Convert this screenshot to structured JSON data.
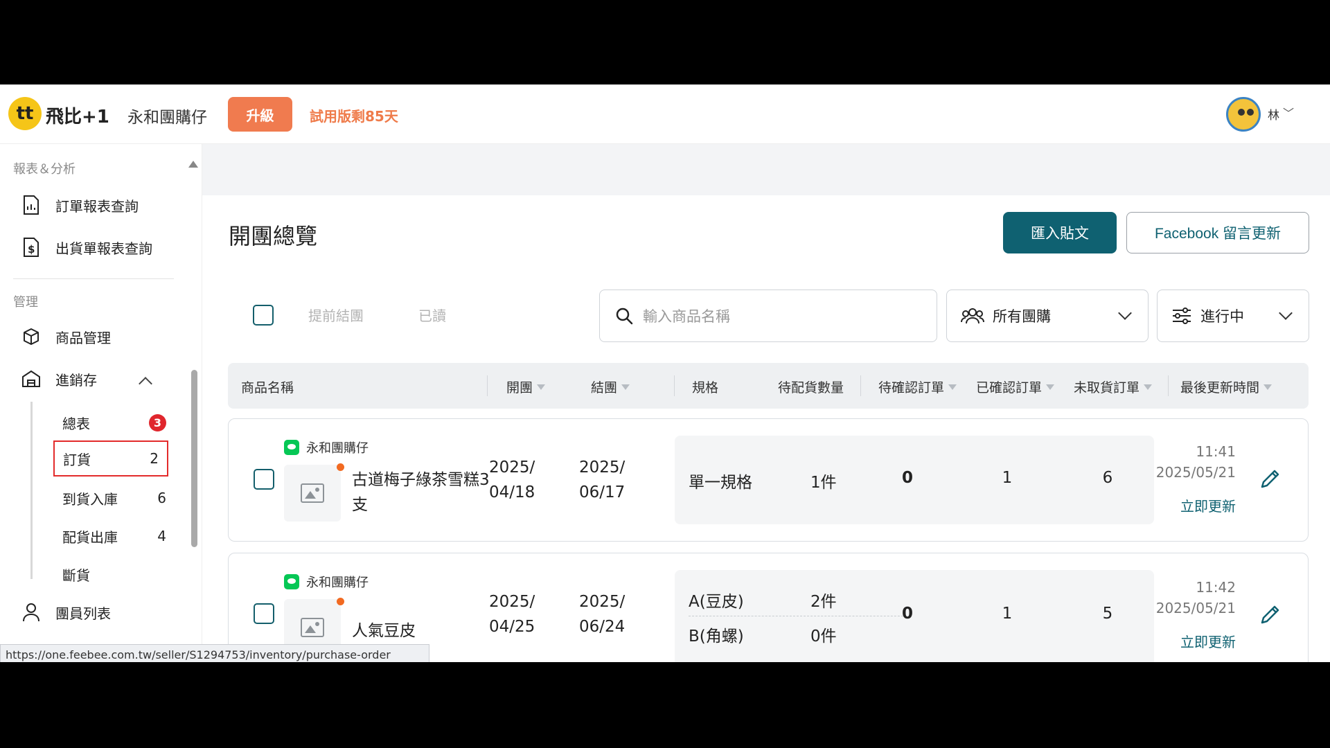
{
  "header": {
    "logo_glyph": "tt",
    "logo_text": "飛比+1",
    "shop_name": "永和團購仔",
    "upgrade_label": "升級",
    "trial_text": "試用版剩85天",
    "user_name": "林",
    "user_chevron": "﹀"
  },
  "sidebar": {
    "section_reports": "報表＆分析",
    "report_items": [
      "訂單報表查詢",
      "出貨單報表查詢"
    ],
    "section_manage": "管理",
    "manage_items": [
      "商品管理",
      "進銷存"
    ],
    "sub_items": [
      {
        "label": "總表",
        "count": ""
      },
      {
        "label": "訂貨",
        "count": "2"
      },
      {
        "label": "到貨入庫",
        "count": "6"
      },
      {
        "label": "配貨出庫",
        "count": "4"
      },
      {
        "label": "斷貨",
        "count": ""
      }
    ],
    "step_badge": "3",
    "member_item": "團員列表"
  },
  "status_url": "https://one.feebee.com.tw/seller/S1294753/inventory/purchase-order",
  "main": {
    "title": "開團總覽",
    "import_button": "匯入貼文",
    "facebook_button": "Facebook 留言更新",
    "filter_close_early": "提前結團",
    "filter_read": "已讀",
    "search_placeholder": "輸入商品名稱",
    "group_select": "所有團購",
    "status_select": "進行中",
    "columns": [
      "商品名稱",
      "開團",
      "結團",
      "規格",
      "待配貨數量",
      "待確認訂單",
      "已確認訂單",
      "未取貨訂單",
      "最後更新時間"
    ],
    "rows": [
      {
        "group": "永和團購仔",
        "name": "古道梅子綠茶雪糕3支",
        "open_date": "2025/ 04/18",
        "close_date": "2025/ 06/17",
        "specs": [
          {
            "name": "單一規格",
            "qty": "1件"
          }
        ],
        "pending": "0",
        "confirmed": "1",
        "unpicked": "6",
        "updated_time": "11:41",
        "updated_date": "2025/05/21",
        "update_link": "立即更新"
      },
      {
        "group": "永和團購仔",
        "name": "人氣豆皮",
        "open_date": "2025/ 04/25",
        "close_date": "2025/ 06/24",
        "specs": [
          {
            "name": "A(豆皮)",
            "qty": "2件"
          },
          {
            "name": "B(角螺)",
            "qty": "0件"
          }
        ],
        "pending": "0",
        "confirmed": "1",
        "unpicked": "5",
        "updated_time": "11:42",
        "updated_date": "2025/05/21",
        "update_link": "立即更新"
      }
    ]
  },
  "colors": {
    "primary": "#0f6171",
    "upgrade": "#f07b4f",
    "trial": "#ef7b4a",
    "highlight_border": "#e32a2a",
    "line_green": "#06c755"
  }
}
